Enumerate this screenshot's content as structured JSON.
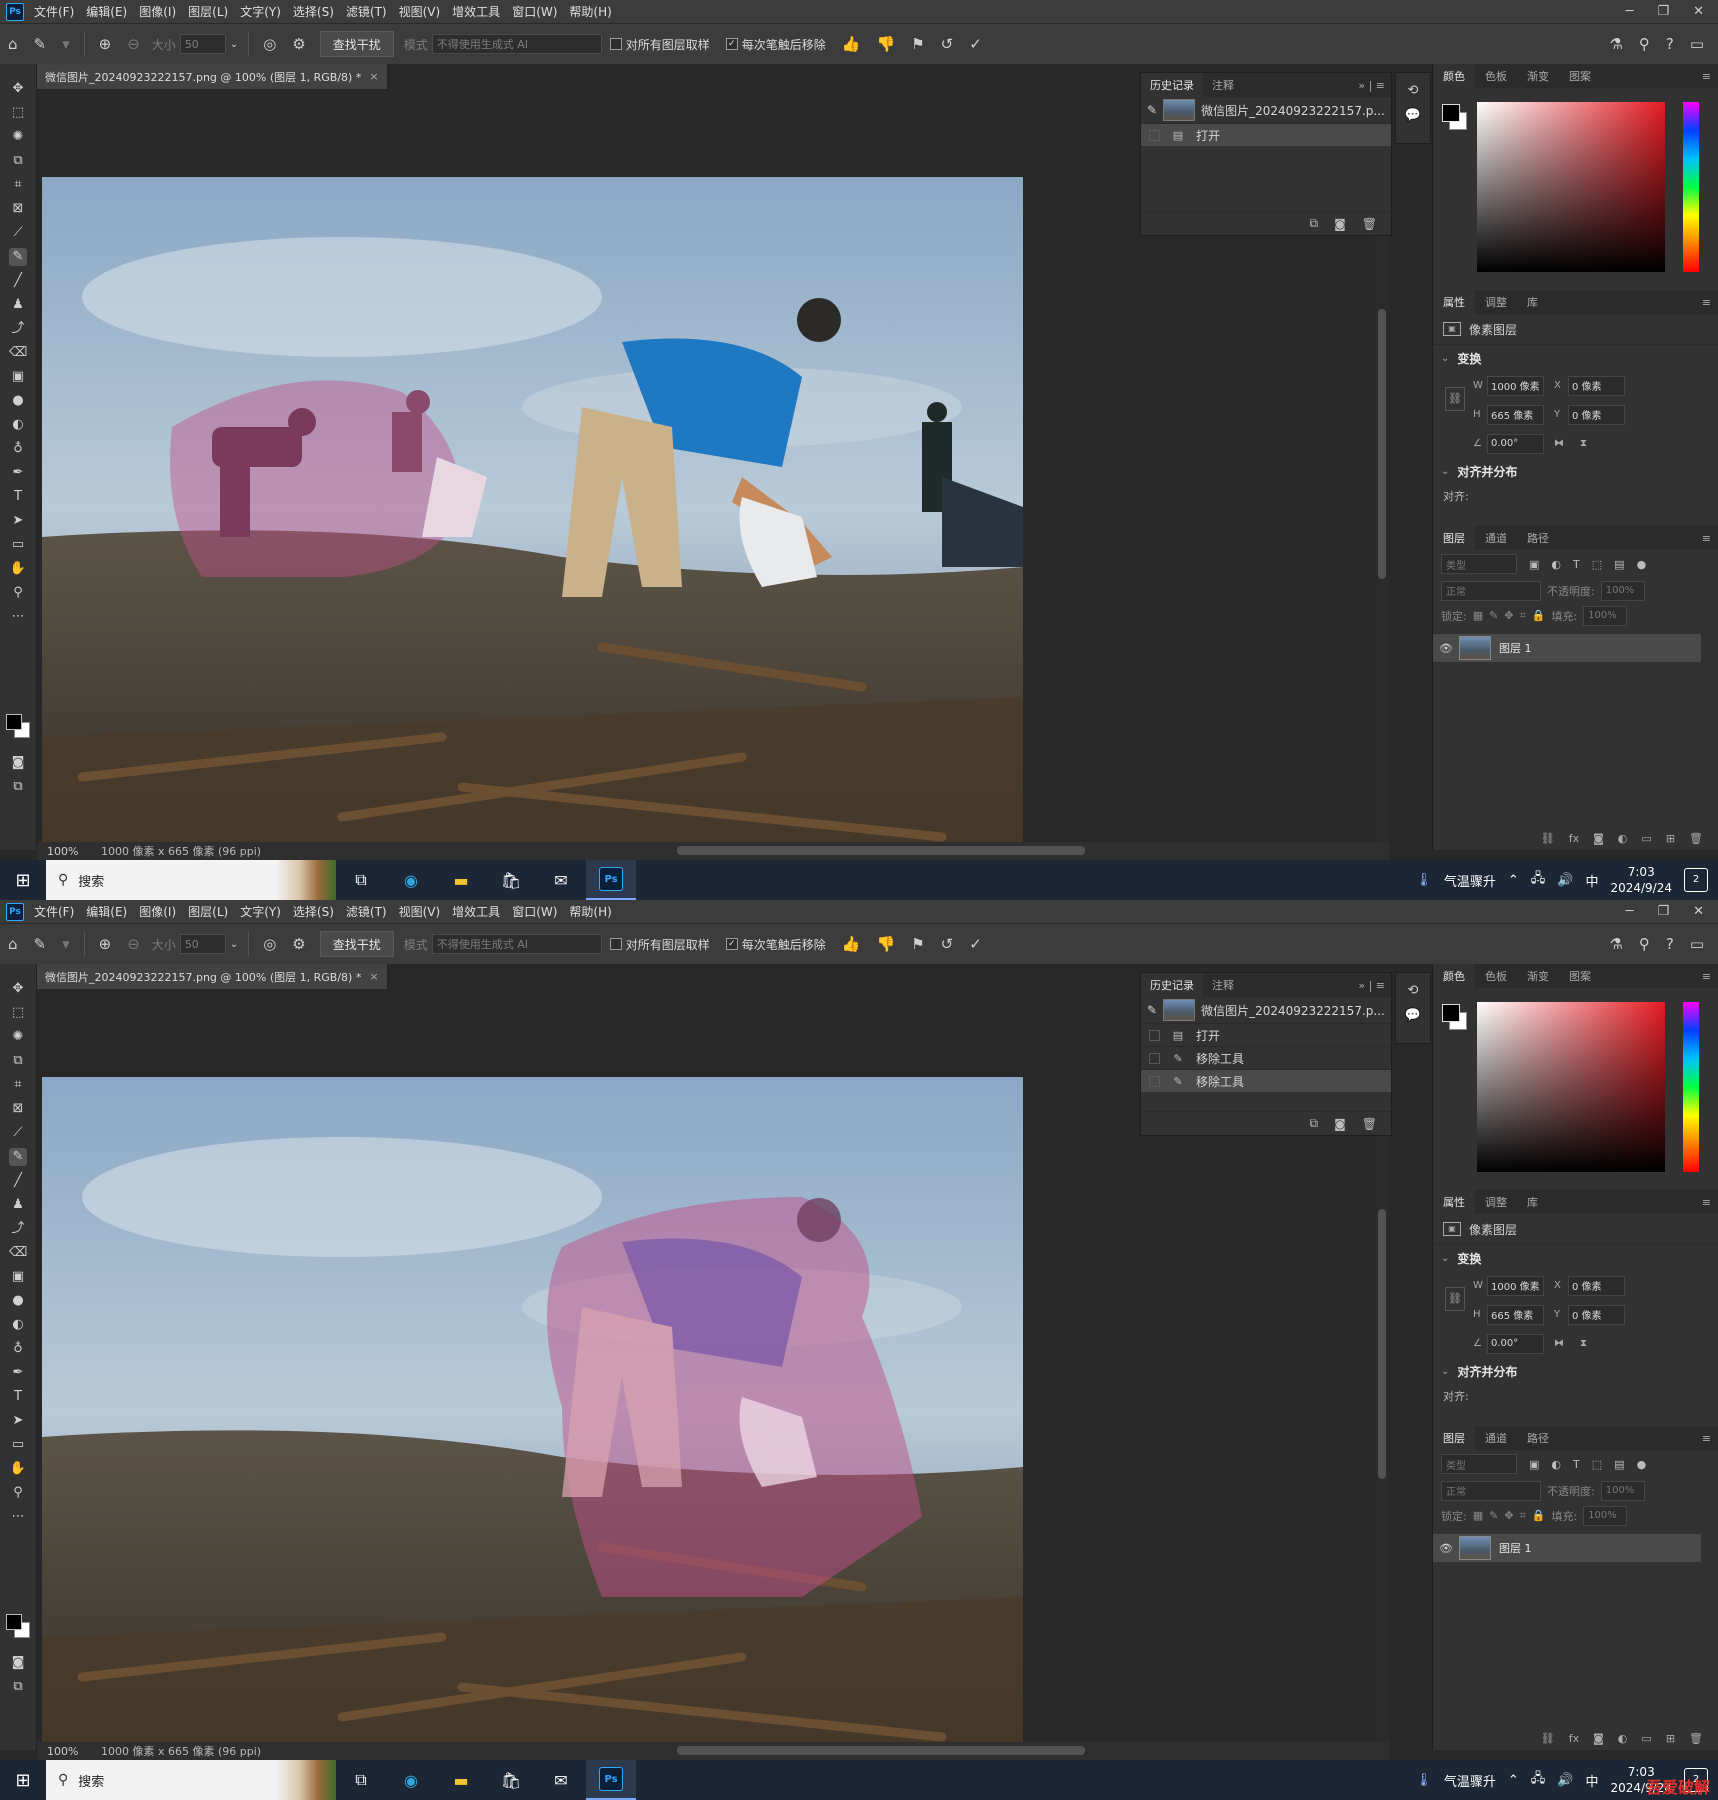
{
  "menu": {
    "items": [
      "文件(F)",
      "编辑(E)",
      "图像(I)",
      "图层(L)",
      "文字(Y)",
      "选择(S)",
      "滤镜(T)",
      "视图(V)",
      "增效工具",
      "窗口(W)",
      "帮助(H)"
    ]
  },
  "options": {
    "size_label": "大小",
    "size_value": "50",
    "find_button": "查找干扰",
    "mode_label": "模式",
    "mode_value": "不得使用生成式 AI",
    "sample_all_label": "对所有图层取样",
    "remove_after_label": "每次笔触后移除"
  },
  "document": {
    "tab_title": "微信图片_20240923222157.png @ 100% (图层 1, RGB/8) *",
    "zoom": "100%",
    "info": "1000 像素 x 665 像素 (96 ppi)"
  },
  "history": {
    "tabs": [
      "历史记录",
      "注释"
    ],
    "snapshot": "微信图片_20240923222157.p...",
    "shot1_items": [
      "打开"
    ],
    "shot2_items": [
      "打开",
      "移除工具",
      "移除工具"
    ]
  },
  "right": {
    "color_tabs": [
      "颜色",
      "色板",
      "渐变",
      "图案"
    ],
    "prop_tabs": [
      "属性",
      "调整",
      "库"
    ],
    "pixel_layer": "像素图层",
    "transform": "变换",
    "w_label": "W",
    "w": "1000 像素",
    "h_label": "H",
    "h": "665 像素",
    "x_label": "X",
    "x": "0 像素",
    "y_label": "Y",
    "y": "0 像素",
    "angle": "0.00°",
    "align_section": "对齐并分布",
    "align_label": "对齐:",
    "layer_tabs": [
      "图层",
      "通道",
      "路径"
    ],
    "kind_placeholder": "类型",
    "blend_mode": "正常",
    "opacity_label": "不透明度:",
    "opacity": "100%",
    "lock_label": "锁定:",
    "fill_label": "填充:",
    "fill": "100%",
    "layer_name": "图层 1"
  },
  "taskbar": {
    "search": "搜索",
    "weather": "气温骤升",
    "ime": "中",
    "time": "7:03",
    "date": "2024/9/24",
    "notif_count": "2"
  },
  "watermark": "吾爱破解",
  "colors": {
    "accent": "#31a8ff",
    "highlight": "#c0508a"
  }
}
